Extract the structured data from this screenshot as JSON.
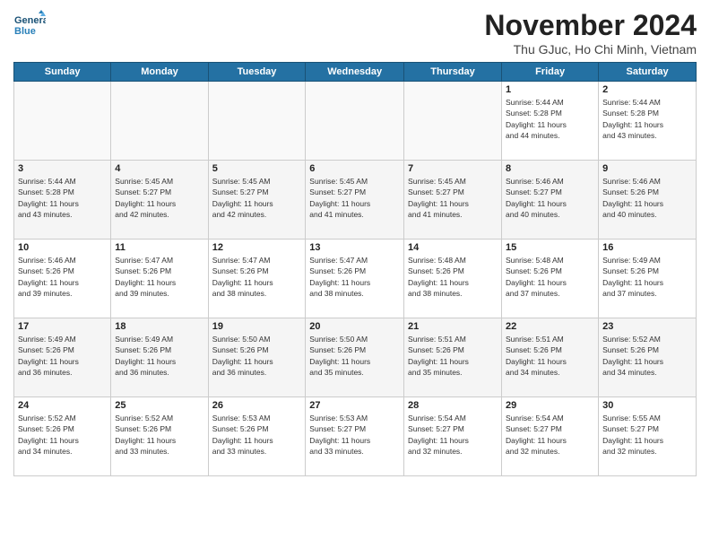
{
  "logo": {
    "line1": "General",
    "line2": "Blue"
  },
  "title": "November 2024",
  "location": "Thu GJuc, Ho Chi Minh, Vietnam",
  "weekdays": [
    "Sunday",
    "Monday",
    "Tuesday",
    "Wednesday",
    "Thursday",
    "Friday",
    "Saturday"
  ],
  "weeks": [
    [
      {
        "day": "",
        "info": ""
      },
      {
        "day": "",
        "info": ""
      },
      {
        "day": "",
        "info": ""
      },
      {
        "day": "",
        "info": ""
      },
      {
        "day": "",
        "info": ""
      },
      {
        "day": "1",
        "info": "Sunrise: 5:44 AM\nSunset: 5:28 PM\nDaylight: 11 hours\nand 44 minutes."
      },
      {
        "day": "2",
        "info": "Sunrise: 5:44 AM\nSunset: 5:28 PM\nDaylight: 11 hours\nand 43 minutes."
      }
    ],
    [
      {
        "day": "3",
        "info": "Sunrise: 5:44 AM\nSunset: 5:28 PM\nDaylight: 11 hours\nand 43 minutes."
      },
      {
        "day": "4",
        "info": "Sunrise: 5:45 AM\nSunset: 5:27 PM\nDaylight: 11 hours\nand 42 minutes."
      },
      {
        "day": "5",
        "info": "Sunrise: 5:45 AM\nSunset: 5:27 PM\nDaylight: 11 hours\nand 42 minutes."
      },
      {
        "day": "6",
        "info": "Sunrise: 5:45 AM\nSunset: 5:27 PM\nDaylight: 11 hours\nand 41 minutes."
      },
      {
        "day": "7",
        "info": "Sunrise: 5:45 AM\nSunset: 5:27 PM\nDaylight: 11 hours\nand 41 minutes."
      },
      {
        "day": "8",
        "info": "Sunrise: 5:46 AM\nSunset: 5:27 PM\nDaylight: 11 hours\nand 40 minutes."
      },
      {
        "day": "9",
        "info": "Sunrise: 5:46 AM\nSunset: 5:26 PM\nDaylight: 11 hours\nand 40 minutes."
      }
    ],
    [
      {
        "day": "10",
        "info": "Sunrise: 5:46 AM\nSunset: 5:26 PM\nDaylight: 11 hours\nand 39 minutes."
      },
      {
        "day": "11",
        "info": "Sunrise: 5:47 AM\nSunset: 5:26 PM\nDaylight: 11 hours\nand 39 minutes."
      },
      {
        "day": "12",
        "info": "Sunrise: 5:47 AM\nSunset: 5:26 PM\nDaylight: 11 hours\nand 38 minutes."
      },
      {
        "day": "13",
        "info": "Sunrise: 5:47 AM\nSunset: 5:26 PM\nDaylight: 11 hours\nand 38 minutes."
      },
      {
        "day": "14",
        "info": "Sunrise: 5:48 AM\nSunset: 5:26 PM\nDaylight: 11 hours\nand 38 minutes."
      },
      {
        "day": "15",
        "info": "Sunrise: 5:48 AM\nSunset: 5:26 PM\nDaylight: 11 hours\nand 37 minutes."
      },
      {
        "day": "16",
        "info": "Sunrise: 5:49 AM\nSunset: 5:26 PM\nDaylight: 11 hours\nand 37 minutes."
      }
    ],
    [
      {
        "day": "17",
        "info": "Sunrise: 5:49 AM\nSunset: 5:26 PM\nDaylight: 11 hours\nand 36 minutes."
      },
      {
        "day": "18",
        "info": "Sunrise: 5:49 AM\nSunset: 5:26 PM\nDaylight: 11 hours\nand 36 minutes."
      },
      {
        "day": "19",
        "info": "Sunrise: 5:50 AM\nSunset: 5:26 PM\nDaylight: 11 hours\nand 36 minutes."
      },
      {
        "day": "20",
        "info": "Sunrise: 5:50 AM\nSunset: 5:26 PM\nDaylight: 11 hours\nand 35 minutes."
      },
      {
        "day": "21",
        "info": "Sunrise: 5:51 AM\nSunset: 5:26 PM\nDaylight: 11 hours\nand 35 minutes."
      },
      {
        "day": "22",
        "info": "Sunrise: 5:51 AM\nSunset: 5:26 PM\nDaylight: 11 hours\nand 34 minutes."
      },
      {
        "day": "23",
        "info": "Sunrise: 5:52 AM\nSunset: 5:26 PM\nDaylight: 11 hours\nand 34 minutes."
      }
    ],
    [
      {
        "day": "24",
        "info": "Sunrise: 5:52 AM\nSunset: 5:26 PM\nDaylight: 11 hours\nand 34 minutes."
      },
      {
        "day": "25",
        "info": "Sunrise: 5:52 AM\nSunset: 5:26 PM\nDaylight: 11 hours\nand 33 minutes."
      },
      {
        "day": "26",
        "info": "Sunrise: 5:53 AM\nSunset: 5:26 PM\nDaylight: 11 hours\nand 33 minutes."
      },
      {
        "day": "27",
        "info": "Sunrise: 5:53 AM\nSunset: 5:27 PM\nDaylight: 11 hours\nand 33 minutes."
      },
      {
        "day": "28",
        "info": "Sunrise: 5:54 AM\nSunset: 5:27 PM\nDaylight: 11 hours\nand 32 minutes."
      },
      {
        "day": "29",
        "info": "Sunrise: 5:54 AM\nSunset: 5:27 PM\nDaylight: 11 hours\nand 32 minutes."
      },
      {
        "day": "30",
        "info": "Sunrise: 5:55 AM\nSunset: 5:27 PM\nDaylight: 11 hours\nand 32 minutes."
      }
    ]
  ]
}
